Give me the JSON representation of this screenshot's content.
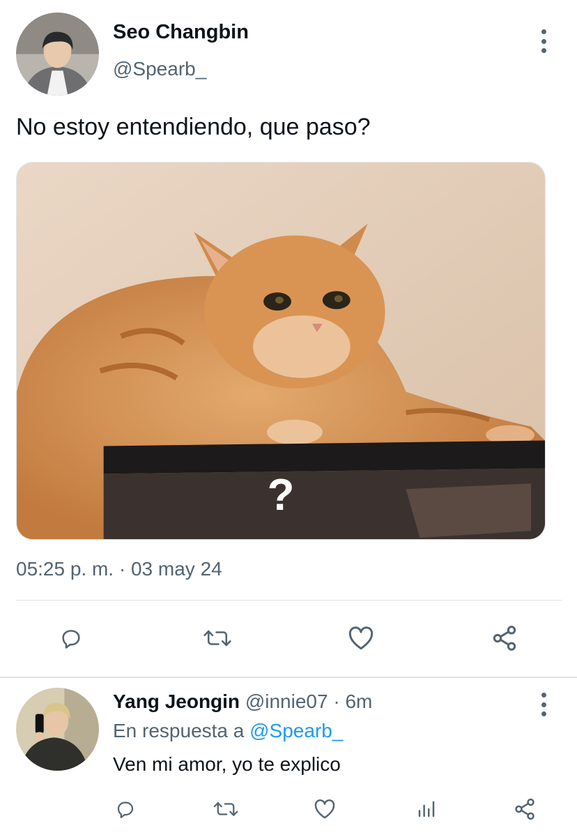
{
  "tweet": {
    "author_name": "Seo Changbin",
    "author_handle": "@Spearb_",
    "text": "No estoy entendiendo, que paso?",
    "media_overlay": "?",
    "timestamp": "05:25 p. m. · 03 may 24",
    "actions": [
      "reply-icon",
      "retweet-icon",
      "heart-icon",
      "share-icon"
    ]
  },
  "reply": {
    "author_name": "Yang Jeongin",
    "author_handle": "@innie07",
    "separator": "·",
    "time": "6m",
    "replying_prefix": "En respuesta a",
    "replying_to": "@Spearb_",
    "text": "Ven mi amor, yo te explico",
    "actions": [
      "reply-icon",
      "retweet-icon",
      "heart-icon",
      "stats-icon",
      "share-icon"
    ]
  },
  "colors": {
    "text_primary": "#0f1419",
    "text_secondary": "#536471",
    "accent": "#1d9bf0",
    "divider": "#dfe3e7"
  }
}
